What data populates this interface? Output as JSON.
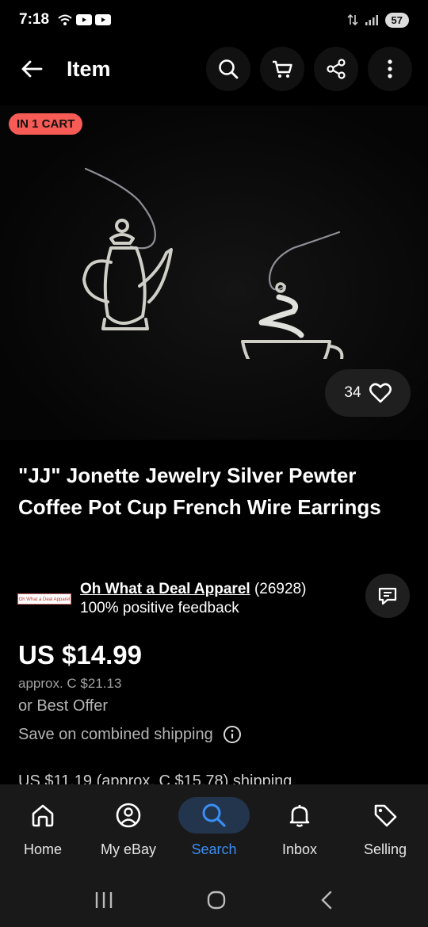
{
  "status": {
    "time": "7:18",
    "battery": "57"
  },
  "appbar": {
    "title": "Item"
  },
  "listing": {
    "badge": "IN 1 CART",
    "likes": "34",
    "title": "\"JJ\" Jonette Jewelry Silver Pewter Coffee Pot Cup French Wire Earrings",
    "seller_logo_text": "Oh What a Deal Apparel",
    "seller_name": "Oh What a Deal Apparel",
    "seller_count": "(26928)",
    "seller_feedback": "100% positive feedback",
    "price": "US $14.99",
    "approx": "approx. C $21.13",
    "best_offer": "or Best Offer",
    "combined_shipping": "Save on combined shipping",
    "shipping": "US $11.19 (approx. C $15.78) shipping"
  },
  "nav": {
    "home": "Home",
    "myebay": "My eBay",
    "search": "Search",
    "inbox": "Inbox",
    "selling": "Selling"
  },
  "colors": {
    "accent": "#3a8ef6",
    "badge": "#f65b55"
  }
}
